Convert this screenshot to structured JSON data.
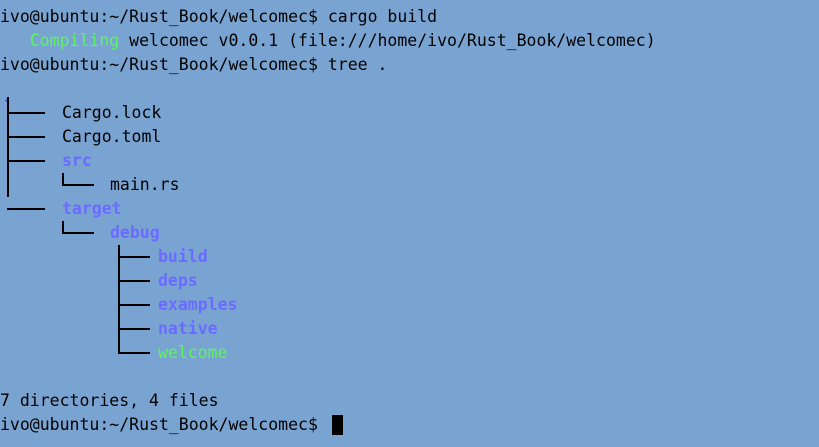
{
  "prompt": "ivo@ubuntu:~/Rust_Book/welcomec$",
  "commands": {
    "build": "cargo build",
    "tree": "tree ."
  },
  "compile_output": {
    "status_word": "Compiling",
    "rest": " welcomec v0.0.1 (file:///home/ivo/Rust_Book/welcomec)"
  },
  "tree": {
    "root": ".",
    "cargo_lock": "Cargo.lock",
    "cargo_toml": "Cargo.toml",
    "src": "src",
    "main_rs": "main.rs",
    "target": "target",
    "debug": "debug",
    "build": "build",
    "deps": "deps",
    "examples": "examples",
    "native": "native",
    "welcome": "welcome"
  },
  "summary": "7 directories, 4 files",
  "colors": {
    "background": "#79a4d2",
    "text": "#000000",
    "directory": "#6b6bff",
    "executable": "#5cf55c"
  }
}
